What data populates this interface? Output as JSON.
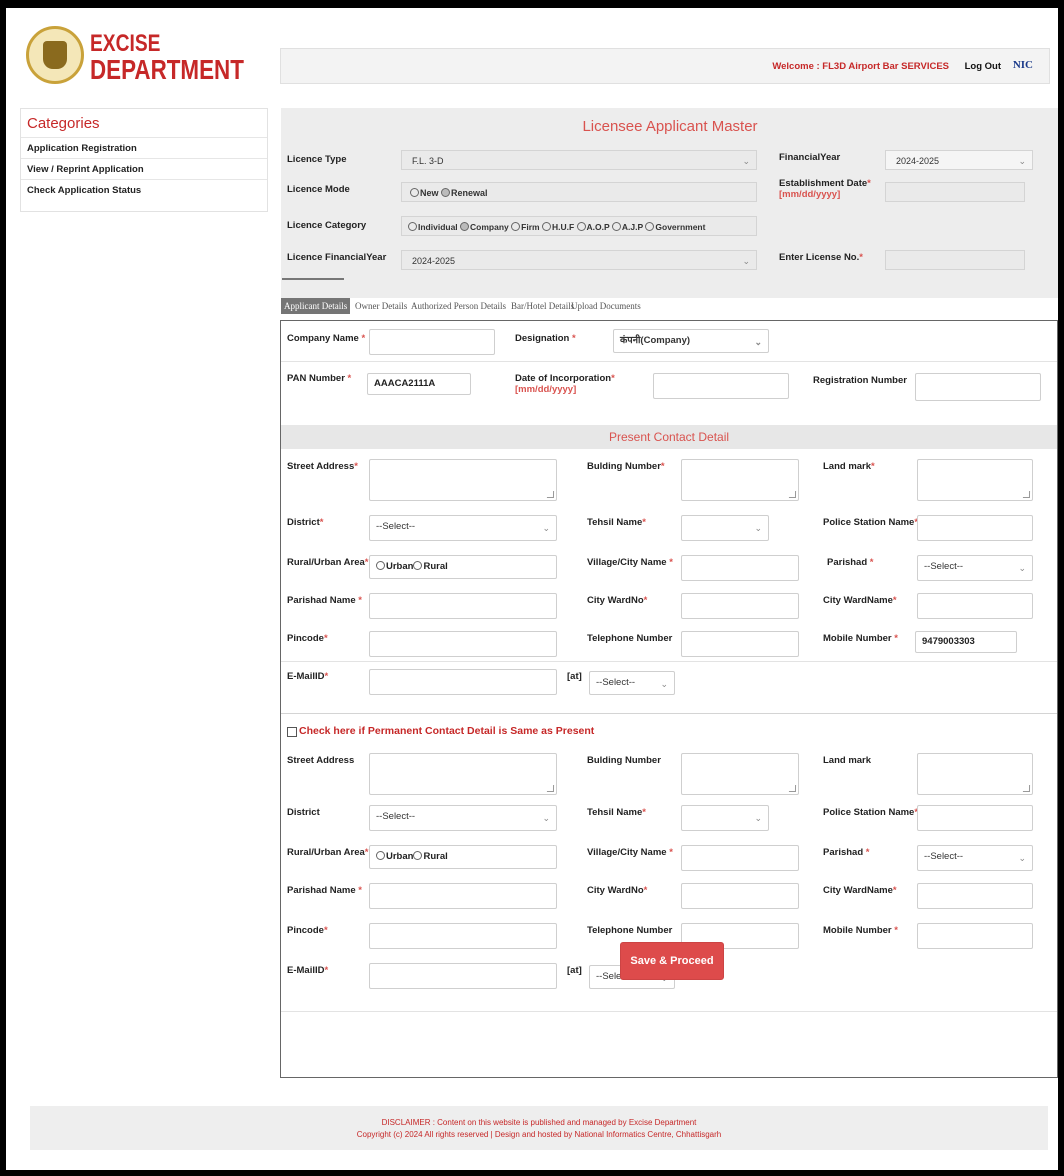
{
  "header": {
    "logo_line1": "EXCISE",
    "logo_line2": "DEPARTMENT",
    "welcome": "Welcome : FL3D Airport Bar SERVICES",
    "logout": "Log Out",
    "nic": "NIC"
  },
  "sidebar": {
    "title": "Categories",
    "items": [
      {
        "label": "Application Registration"
      },
      {
        "label": "View / Reprint Application"
      },
      {
        "label": "Check Application Status"
      }
    ]
  },
  "master": {
    "title": "Licensee Applicant Master",
    "licence_type_label": "Licence Type",
    "licence_type_value": "F.L. 3-D",
    "financial_year_label": "FinancialYear",
    "financial_year_value": "2024-2025",
    "licence_mode_label": "Licence Mode",
    "mode_new": "New",
    "mode_renewal": "Renewal",
    "establishment_date_label": "Establishment Date",
    "date_format": "[mm/dd/yyyy]",
    "licence_category_label": "Licence Category",
    "categories": [
      "Individual",
      "Company",
      "Firm",
      "H.U.F",
      "A.O.P",
      "A.J.P",
      "Government"
    ],
    "licence_fy_label": "Licence FinancialYear",
    "licence_fy_value": "2024-2025",
    "license_no_label": "Enter License No."
  },
  "tabs": [
    {
      "label": "Applicant Details"
    },
    {
      "label": "Owner Details"
    },
    {
      "label": "Authorized Person Details"
    },
    {
      "label": "Bar/Hotel Details"
    },
    {
      "label": "Upload Documents"
    }
  ],
  "applicant": {
    "company_name_label": "Company Name",
    "designation_label": "Designation",
    "designation_value": "कंपनी(Company)",
    "pan_label": "PAN Number",
    "pan_value": "AAACA2111A",
    "doi_label": "Date of Incorporation",
    "doi_format": "[mm/dd/yyyy]",
    "reg_no_label": "Registration Number"
  },
  "present": {
    "title": "Present Contact Detail",
    "street_label": "Street Address",
    "building_label": "Bulding Number",
    "landmark_label": "Land mark",
    "district_label": "District",
    "district_value": "--Select--",
    "tehsil_label": "Tehsil Name",
    "police_label": "Police Station Name",
    "rural_label": "Rural/Urban Area",
    "urban": "Urban",
    "rural": "Rural",
    "village_label": "Village/City Name",
    "parishad_label": "Parishad",
    "parishad_value": "--Select--",
    "parishad_name_label": "Parishad Name",
    "ward_no_label": "City WardNo",
    "ward_name_label": "City WardName",
    "pincode_label": "Pincode",
    "telephone_label": "Telephone Number",
    "mobile_label": "Mobile Number",
    "mobile_value": "9479003303",
    "email_label": "E-MailID",
    "at_label": "[at]",
    "email_domain_value": "--Select--"
  },
  "permanent": {
    "same_check_label": "Check here if Permanent Contact Detail is Same as Present",
    "street_label": "Street Address",
    "building_label": "Bulding Number",
    "landmark_label": "Land mark",
    "district_label": "District",
    "district_value": "--Select--",
    "tehsil_label": "Tehsil Name",
    "police_label": "Police Station Name",
    "rural_label": "Rural/Urban Area",
    "urban": "Urban",
    "rural": "Rural",
    "village_label": "Village/City Name",
    "parishad_label": "Parishad",
    "parishad_value": "--Select--",
    "parishad_name_label": "Parishad Name",
    "ward_no_label": "City WardNo",
    "ward_name_label": "City WardName",
    "pincode_label": "Pincode",
    "telephone_label": "Telephone Number",
    "mobile_label": "Mobile Number",
    "email_label": "E-MailID",
    "at_label": "[at]",
    "email_domain_value": "--Select--"
  },
  "actions": {
    "save_label": "Save & Proceed"
  },
  "footer": {
    "disclaimer": "DISCLAIMER : Content on this website is published and managed by Excise Department",
    "copyright": "Copyright (c) 2024 All rights reserved | Design and hosted by National Informatics Centre, Chhattisgarh"
  },
  "colors": {
    "accent": "#d9534f",
    "brand_red": "#c62828",
    "nic_blue": "#1a3a8a"
  }
}
